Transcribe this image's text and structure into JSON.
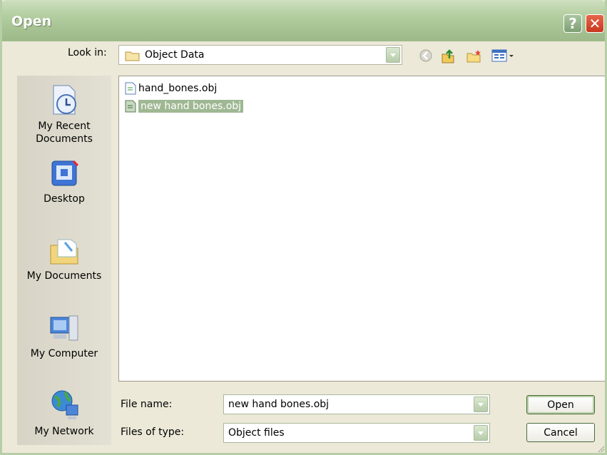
{
  "window": {
    "title": "Open"
  },
  "toolbar": {
    "look_in_label": "Look in:",
    "look_in_value": "Object Data"
  },
  "places": [
    {
      "name": "recent",
      "label_line1": "My Recent",
      "label_line2": "Documents"
    },
    {
      "name": "desktop",
      "label_line1": "Desktop",
      "label_line2": ""
    },
    {
      "name": "documents",
      "label_line1": "My Documents",
      "label_line2": ""
    },
    {
      "name": "computer",
      "label_line1": "My Computer",
      "label_line2": ""
    },
    {
      "name": "network",
      "label_line1": "My Network",
      "label_line2": ""
    }
  ],
  "files": [
    {
      "name": "hand_bones.obj",
      "selected": false
    },
    {
      "name": "new hand bones.obj",
      "selected": true
    }
  ],
  "form": {
    "file_name_label": "File name:",
    "file_name_value": "new hand bones.obj",
    "file_type_label": "Files of type:",
    "file_type_value": "Object files"
  },
  "buttons": {
    "open": "Open",
    "cancel": "Cancel"
  }
}
